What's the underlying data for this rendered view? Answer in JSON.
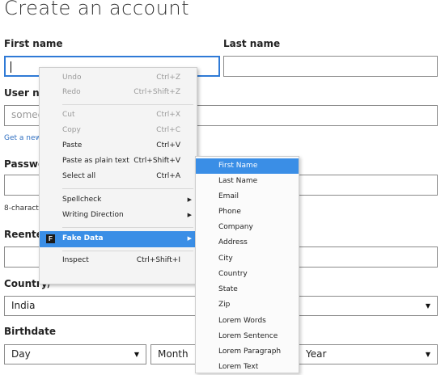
{
  "page": {
    "title": "Create an account",
    "first_name_label": "First name",
    "last_name_label": "Last name",
    "username_label": "User na",
    "username_placeholder": "somec",
    "get_new_link": "Get a new",
    "password_label": "Passwo",
    "password_hint": "8-characte",
    "reenter_label": "Reenter",
    "country_label": "Country/",
    "country_value": "India",
    "birthdate_label": "Birthdate",
    "day_value": "Day",
    "month_value": "Month",
    "year_value": "Year"
  },
  "context_menu": {
    "items": [
      {
        "label": "Undo",
        "shortcut": "Ctrl+Z"
      },
      {
        "label": "Redo",
        "shortcut": "Ctrl+Shift+Z"
      },
      {
        "label": "Cut",
        "shortcut": "Ctrl+X"
      },
      {
        "label": "Copy",
        "shortcut": "Ctrl+C"
      },
      {
        "label": "Paste",
        "shortcut": "Ctrl+V"
      },
      {
        "label": "Paste as plain text",
        "shortcut": "Ctrl+Shift+V"
      },
      {
        "label": "Select all",
        "shortcut": "Ctrl+A"
      },
      {
        "label": "Spellcheck"
      },
      {
        "label": "Writing Direction"
      },
      {
        "label": "Fake Data"
      },
      {
        "label": "Inspect",
        "shortcut": "Ctrl+Shift+I"
      }
    ],
    "fake_data_icon_letter": "F"
  },
  "fake_data_submenu": {
    "items": [
      "First Name",
      "Last Name",
      "Email",
      "Phone",
      "Company",
      "Address",
      "City",
      "Country",
      "State",
      "Zip",
      "Lorem Words",
      "Lorem Sentence",
      "Lorem Paragraph",
      "Lorem Text"
    ]
  },
  "colors": {
    "accent": "#3a8ee6",
    "focus_border": "#2f7ad6"
  },
  "icons": {
    "dropdown": "chevron-down-icon",
    "submenu": "chevron-right-icon"
  }
}
